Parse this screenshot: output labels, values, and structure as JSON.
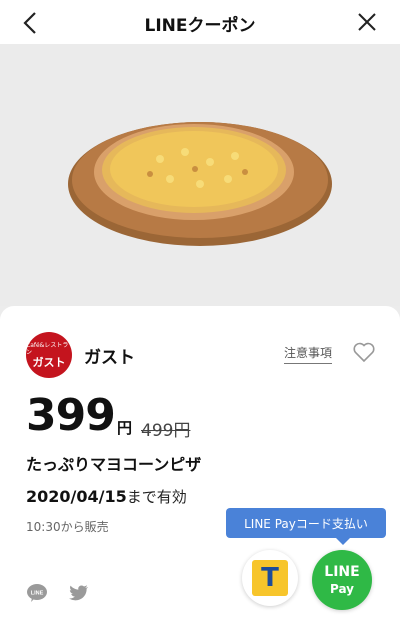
{
  "header": {
    "title": "LINEクーポン"
  },
  "shop": {
    "logo_small": "Café&レストラン",
    "logo_main": "ガスト",
    "name": "ガスト",
    "notice_link": "注意事項"
  },
  "coupon": {
    "price": "399",
    "price_unit": "円",
    "original_price": "499円",
    "product_name": "たっぷりマヨコーンピザ",
    "expiry_date": "2020/04/15",
    "expiry_suffix": "まで有効",
    "sale_time": "10:30から販売"
  },
  "payment": {
    "tooltip": "LINE Payコード支払い",
    "tpoint_letter": "T",
    "linepay_line1": "LINE",
    "linepay_line2": "Pay"
  },
  "icons": {
    "back": "chevron-left-icon",
    "close": "close-icon",
    "favorite": "heart-icon",
    "share_line": "line-icon",
    "share_twitter": "twitter-icon"
  },
  "colors": {
    "brand_red": "#c4141e",
    "tooltip_blue": "#4a82d8",
    "line_green": "#2fb946",
    "tpoint_yellow": "#f7c52b",
    "tpoint_blue": "#1c4c9a"
  }
}
